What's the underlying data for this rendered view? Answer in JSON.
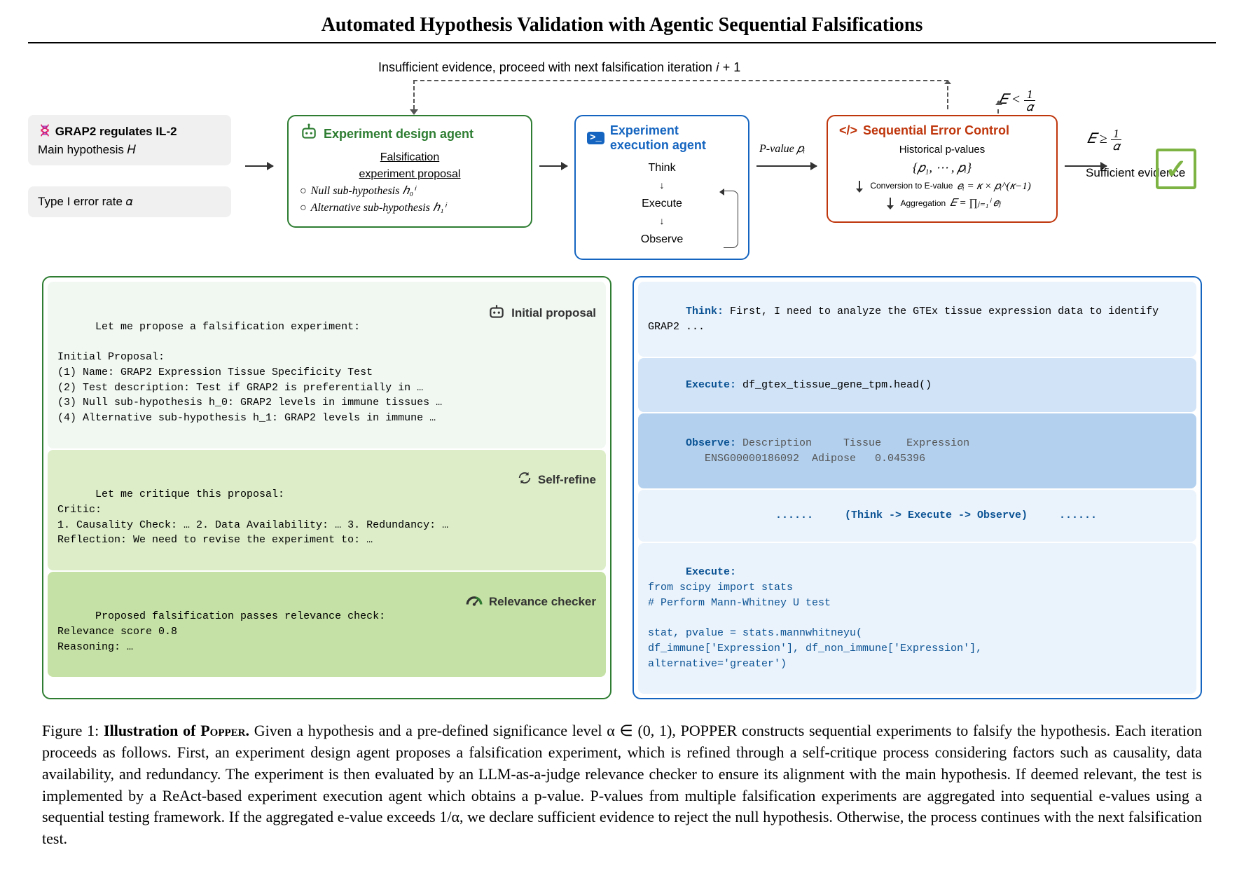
{
  "header": {
    "title": "Automated Hypothesis Validation with Agentic Sequential Falsifications"
  },
  "flow": {
    "feedback": "Insufficient evidence, proceed with next falsification iteration 𝑖 + 1",
    "input_hyp_title": "GRAP2 regulates IL-2",
    "input_hyp_sub": "Main hypothesis 𝐻",
    "input_alpha": "Type I error rate  𝛼",
    "design_title": "Experiment design agent",
    "design_l1": "Falsification",
    "design_l2": "experiment proposal",
    "design_l3": "Null sub-hypothesis ℎ₀ⁱ",
    "design_l4": "Alternative sub-hypothesis ℎ₁ⁱ",
    "exec_title": "Experiment execution agent",
    "exec_think": "Think",
    "exec_execute": "Execute",
    "exec_observe": "Observe",
    "pvalue_label": "P-value 𝑝ᵢ",
    "error_title": "Sequential Error Control",
    "error_hist": "Historical p-values",
    "error_set": "{𝑝₁, ⋯ , 𝑝ᵢ}",
    "error_conv": "Conversion to E-value",
    "error_conv_f": "𝑒ᵢ = 𝜅 × 𝑝ᵢ^(𝜅−1)",
    "error_agg": "Aggregation",
    "error_agg_f": "𝐸 = ∏ⱼ₌₁ⁱ 𝑒ⱼ",
    "thresh_lt": "𝐸 < ",
    "thresh_ge": "𝐸 ≥ ",
    "sufficient": "Sufficient evidence"
  },
  "detail_green": {
    "s1_label": "Initial proposal",
    "s1_text": "Let me propose a falsification experiment:\n\nInitial Proposal:\n(1) Name: GRAP2 Expression Tissue Specificity Test\n(2) Test description: Test if GRAP2 is preferentially in …\n(3) Null sub-hypothesis h_0: GRAP2 levels in immune tissues …\n(4) Alternative sub-hypothesis h_1: GRAP2 levels in immune …",
    "s2_label": "Self-refine",
    "s2_text": "Let me critique this proposal:\nCritic:\n1. Causality Check: … 2. Data Availability: … 3. Redundancy: …\nReflection: We need to revise the experiment to: …",
    "s3_label": "Relevance checker",
    "s3_text": "Proposed falsification passes relevance check:\nRelevance score 0.8\nReasoning: …"
  },
  "detail_blue": {
    "think_label": "Think:",
    "think_text": " First, I need to analyze the GTEx tissue expression data to identify GRAP2 ...",
    "exec1_label": "Execute:",
    "exec1_text": " df_gtex_tissue_gene_tpm.head()",
    "obs_label": "Observe:",
    "obs_text": " Description     Tissue    Expression\n         ENSG00000186092  Adipose   0.045396",
    "loop": "......     (Think -> Execute -> Observe)     ......",
    "exec2_label": "Execute:",
    "exec2_text": "from scipy import stats\n# Perform Mann-Whitney U test\n\nstat, pvalue = stats.mannwhitneyu(\ndf_immune['Expression'], df_non_immune['Expression'],\nalternative='greater')"
  },
  "caption": {
    "prefix": "Figure 1: ",
    "bold": "Illustration of POPPER.",
    "body": " Given a hypothesis and a pre-defined significance level α ∈ (0, 1), POPPER constructs sequential experiments to falsify the hypothesis. Each iteration proceeds as follows. First, an experiment design agent proposes a falsification experiment, which is refined through a self-critique process considering factors such as causality, data availability, and redundancy. The experiment is then evaluated by an LLM-as-a-judge relevance checker to ensure its alignment with the main hypothesis. If deemed relevant, the test is implemented by a ReAct-based experiment execution agent which obtains a p-value. P-values from multiple falsification experiments are aggregated into sequential e-values using a sequential testing framework. If the aggregated e-value exceeds 1/α, we declare sufficient evidence to reject the null hypothesis. Otherwise, the process continues with the next falsification test."
  }
}
